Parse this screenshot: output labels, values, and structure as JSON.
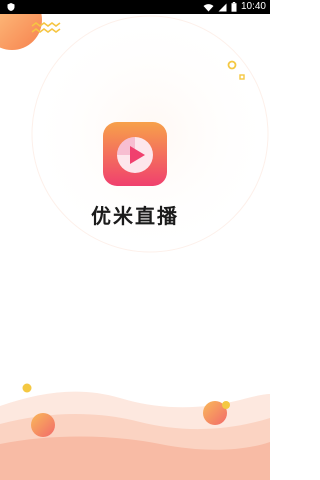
{
  "status_bar": {
    "time": "10:40",
    "icons": [
      "shield-icon",
      "wifi-icon",
      "cellular-signal-icon",
      "battery-icon"
    ]
  },
  "app": {
    "name": "优米直播",
    "logo_icon": "play-icon"
  },
  "colors": {
    "logo_gradient_top": "#f7a14a",
    "logo_gradient_bottom": "#f0406e",
    "accent_orange": "#f6a64a",
    "accent_pink": "#f26a6a",
    "accent_yellow": "#f4c842",
    "wave_light": "#fde6dc",
    "wave_mid": "#f9c9b6"
  }
}
